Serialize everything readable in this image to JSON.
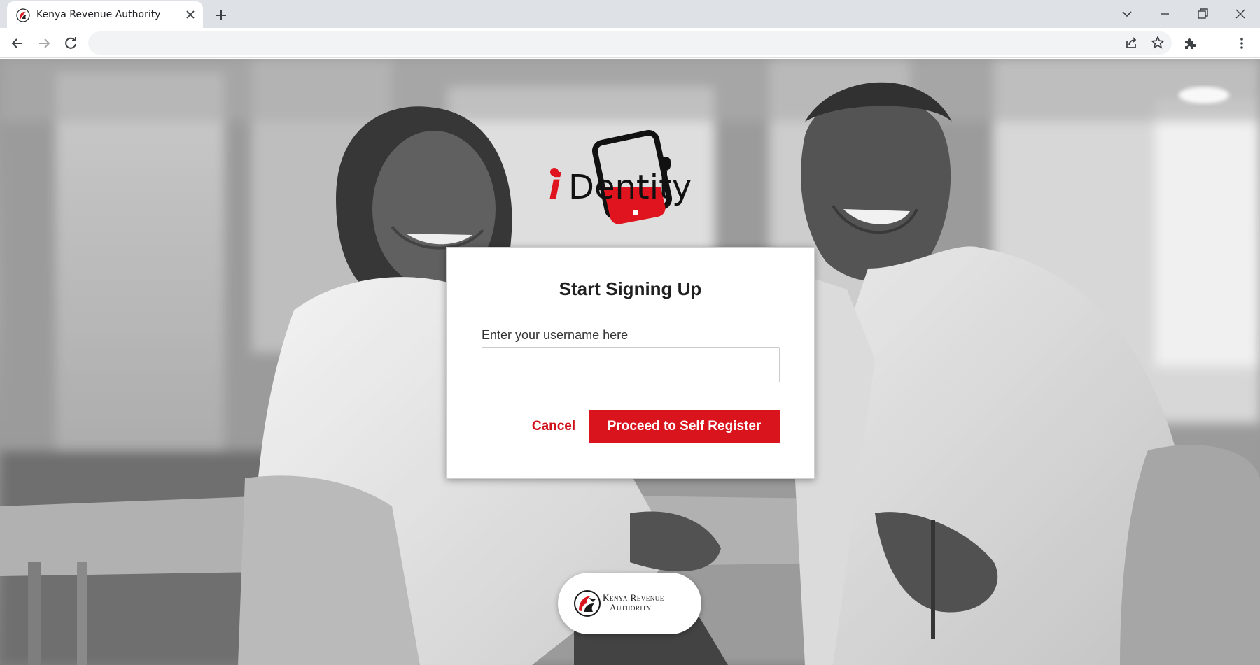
{
  "browser": {
    "tab_title": "Kenya Revenue Authority",
    "address": ""
  },
  "logo": {
    "wordmark_i": "i",
    "wordmark_rest": "Dentity"
  },
  "form": {
    "title": "Start Signing Up",
    "username_label": "Enter your username here",
    "username_value": "",
    "cancel_label": "Cancel",
    "proceed_label": "Proceed to Self Register"
  },
  "footer_badge": {
    "line1": "Kenya Revenue",
    "line2": "Authority"
  },
  "colors": {
    "brand_red": "#d9141d",
    "tabstrip": "#dee1e6",
    "omnibox": "#f1f3f4"
  },
  "icons": [
    "kra-favicon-icon",
    "close-icon",
    "plus-icon",
    "chevron-down-icon",
    "minimize-icon",
    "restore-icon",
    "back-arrow-icon",
    "forward-arrow-icon",
    "reload-icon",
    "share-icon",
    "star-icon",
    "puzzle-icon",
    "more-vert-icon",
    "phone-icon",
    "microphone-icon",
    "lion-emblem-icon"
  ]
}
